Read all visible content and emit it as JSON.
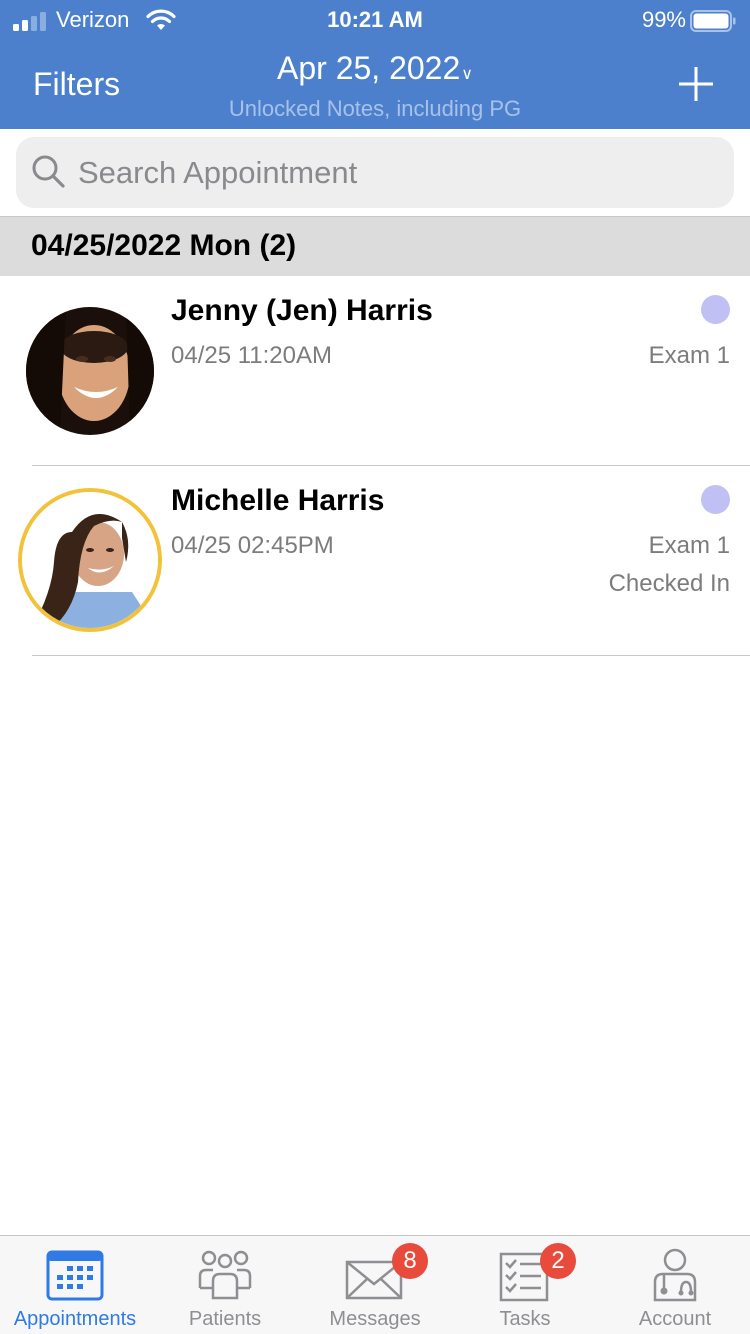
{
  "status_bar": {
    "carrier": "Verizon",
    "time": "10:21 AM",
    "battery": "99%",
    "battery_level": 0.99,
    "signal_bars_filled": 2,
    "signal_bars_total": 4
  },
  "nav": {
    "filters_label": "Filters",
    "date_label": "Apr 25, 2022",
    "date_chevron": "∨",
    "subtitle": "Unlocked Notes, including PG",
    "add_icon": "plus-icon"
  },
  "search": {
    "placeholder": "Search Appointment",
    "value": ""
  },
  "section": {
    "title": "04/25/2022 Mon (2)"
  },
  "appointments": [
    {
      "name": "Jenny (Jen) Harris",
      "time": "04/25 11:20AM",
      "room": "Exam 1",
      "status": "",
      "dot_color": "#c0c0f4",
      "checked_in_ring": false
    },
    {
      "name": "Michelle Harris",
      "time": "04/25 02:45PM",
      "room": "Exam 1",
      "status": "Checked In",
      "dot_color": "#c0c0f4",
      "checked_in_ring": true,
      "ring_color": "#f2c23a"
    }
  ],
  "tabs": [
    {
      "label": "Appointments",
      "icon": "calendar-icon",
      "active": true,
      "badge": ""
    },
    {
      "label": "Patients",
      "icon": "patients-icon",
      "active": false,
      "badge": ""
    },
    {
      "label": "Messages",
      "icon": "envelope-icon",
      "active": false,
      "badge": "8"
    },
    {
      "label": "Tasks",
      "icon": "checklist-icon",
      "active": false,
      "badge": "2"
    },
    {
      "label": "Account",
      "icon": "doctor-icon",
      "active": false,
      "badge": ""
    }
  ],
  "colors": {
    "header_bg": "#4d80cc",
    "active_tab": "#2f7ae5",
    "badge": "#e84a3c",
    "status_dot": "#c0c0f4",
    "checked_in_ring": "#f2c23a"
  }
}
